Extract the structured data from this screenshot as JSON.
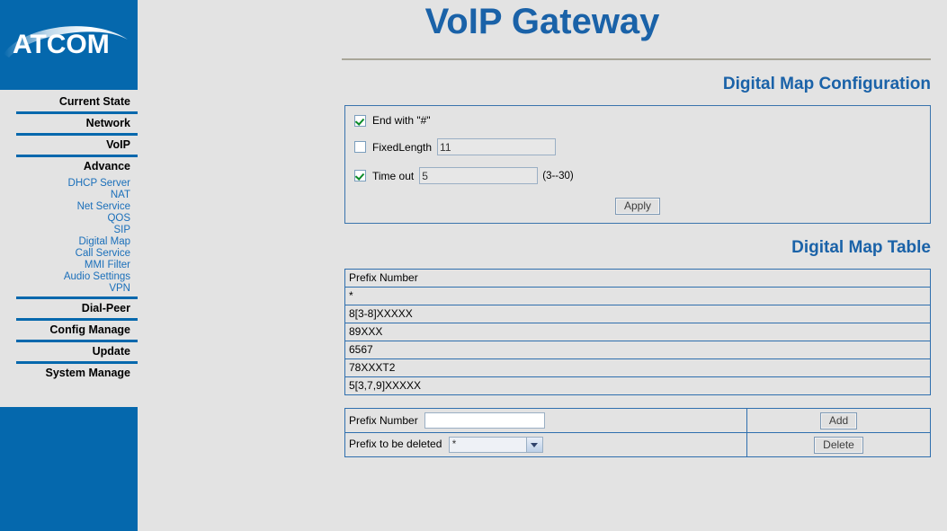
{
  "brand": {
    "logo_text": "ATCOM"
  },
  "header": {
    "title": "VoIP Gateway"
  },
  "sidebar": {
    "top_items": [
      {
        "label": "Current State"
      },
      {
        "label": "Network"
      },
      {
        "label": "VoIP"
      },
      {
        "label": "Advance"
      }
    ],
    "sub_items": [
      {
        "label": "DHCP Server"
      },
      {
        "label": "NAT"
      },
      {
        "label": "Net Service"
      },
      {
        "label": "QOS"
      },
      {
        "label": "SIP"
      },
      {
        "label": "Digital Map"
      },
      {
        "label": "Call Service"
      },
      {
        "label": "MMI Filter"
      },
      {
        "label": "Audio Settings"
      },
      {
        "label": "VPN"
      }
    ],
    "bottom_items": [
      {
        "label": "Dial-Peer"
      },
      {
        "label": "Config Manage"
      },
      {
        "label": "Update"
      },
      {
        "label": "System Manage"
      }
    ]
  },
  "config": {
    "heading": "Digital Map Configuration",
    "end_with_hash": {
      "label": "End with \"#\"",
      "checked": true
    },
    "fixed_length": {
      "label": "FixedLength",
      "checked": false,
      "value": "11"
    },
    "time_out": {
      "label": "Time out",
      "checked": true,
      "value": "5",
      "hint": "(3--30)"
    },
    "apply_label": "Apply"
  },
  "table": {
    "heading": "Digital Map Table",
    "column_header": "Prefix Number",
    "rows": [
      "*",
      "8[3-8]XXXXX",
      "89XXX",
      "6567",
      "78XXXT2",
      "5[3,7,9]XXXXX"
    ]
  },
  "actions": {
    "prefix_number_label": "Prefix Number",
    "prefix_number_value": "",
    "add_label": "Add",
    "prefix_delete_label": "Prefix to be deleted",
    "prefix_delete_selected": "*",
    "delete_label": "Delete"
  },
  "colors": {
    "brand_blue": "#0568ad",
    "heading_blue": "#1a62a8",
    "link_blue": "#1a6fba",
    "border_blue": "#2f6fae",
    "page_bg": "#e3e3e3",
    "check_green": "#0a8a27"
  }
}
